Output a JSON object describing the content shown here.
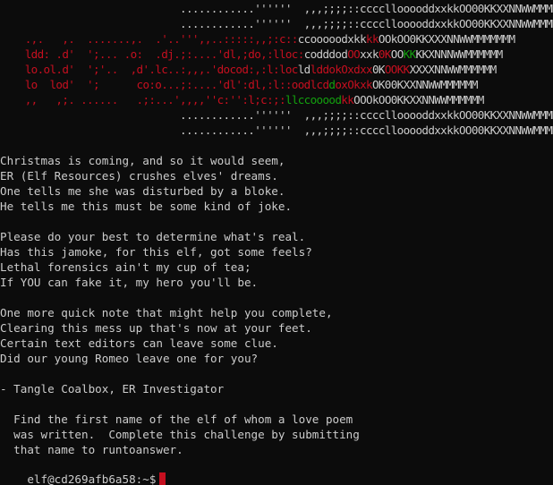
{
  "colors": {
    "background": "#0c0c0c",
    "foreground": "#cccccc",
    "red": "#c50f1f",
    "green": "#13a10e",
    "cursor": "#c50f1f"
  },
  "art": [
    [
      {
        "t": "                             ............''''''  ,,,;;;;::ccccllooooddxxkkOO00KKXXNNWWMMMMMM",
        "c": "#cccccc"
      }
    ],
    [
      {
        "t": "                             ............''''''  ,,,;;;;::ccccllooooddxxkkOO00KKXXNNWWMMMMMM",
        "c": "#cccccc"
      }
    ],
    [
      {
        "t": "    .,.   ,.  .......,.  .'..''',,..:::::,,;:c::",
        "c": "#c50f1f"
      },
      {
        "t": "ccooooodxkk",
        "c": "#cccccc"
      },
      {
        "t": "kk",
        "c": "#c50f1f"
      },
      {
        "t": "OOkOO0KKXXXNNWWMMMMMMM",
        "c": "#cccccc"
      }
    ],
    [
      {
        "t": "    ldd: .d'  ';... .o:  .dj.;:....'dl,;do,:lloc:",
        "c": "#c50f1f"
      },
      {
        "t": "codddod",
        "c": "#cccccc"
      },
      {
        "t": "OO",
        "c": "#c50f1f"
      },
      {
        "t": "xxk",
        "c": "#cccccc"
      },
      {
        "t": "0K",
        "c": "#c50f1f"
      },
      {
        "t": "OO",
        "c": "#cccccc"
      },
      {
        "t": "KK",
        "c": "#13a10e"
      },
      {
        "t": "KKXNNNWWMMMMMM",
        "c": "#cccccc"
      }
    ],
    [
      {
        "t": "    lo.ol.d'  ';'..  ,d'.lc..:,,,.'docod:,:l:loc",
        "c": "#c50f1f"
      },
      {
        "t": "ld",
        "c": "#cccccc"
      },
      {
        "t": "lddokOxdxx",
        "c": "#c50f1f"
      },
      {
        "t": "0K",
        "c": "#cccccc"
      },
      {
        "t": "OOKK",
        "c": "#c50f1f"
      },
      {
        "t": "XXXXNNWWMMMMMM",
        "c": "#cccccc"
      }
    ],
    [
      {
        "t": "    lo  lod'  ';      co:o...;:....'dl':dl,:l::oodlcd",
        "c": "#c50f1f"
      },
      {
        "t": "d",
        "c": "#13a10e"
      },
      {
        "t": "oxOkxk",
        "c": "#c50f1f"
      },
      {
        "t": "OK00KXXNNWWMMMMMM",
        "c": "#cccccc"
      }
    ],
    [
      {
        "t": "    ,,   ,;. ......   .;:...',,,,''c:'':l;c:;:",
        "c": "#c50f1f"
      },
      {
        "t": "llccooood",
        "c": "#13a10e"
      },
      {
        "t": "kk",
        "c": "#c50f1f"
      },
      {
        "t": "OOOkOO0KKXXNNWWMMMMMM",
        "c": "#cccccc"
      }
    ],
    [
      {
        "t": "                             ............''''''  ,,,;;;;::ccccllooooddxxkkOO00KKXXNNWWMMMMMM",
        "c": "#cccccc"
      }
    ],
    [
      {
        "t": "                             ............''''''  ,,,;;;;::ccccllooooddxxkkOO00KKXXNNWWMMMMMM",
        "c": "#cccccc"
      }
    ]
  ],
  "text_lines": [
    "Christmas is coming, and so it would seem,",
    "ER (Elf Resources) crushes elves' dreams.",
    "One tells me she was disturbed by a bloke.",
    "He tells me this must be some kind of joke.",
    "",
    "Please do your best to determine what's real.",
    "Has this jamoke, for this elf, got some feels?",
    "Lethal forensics ain't my cup of tea;",
    "If YOU can fake it, my hero you'll be.",
    "",
    "One more quick note that might help you complete,",
    "Clearing this mess up that's now at your feet.",
    "Certain text editors can leave some clue.",
    "Did our young Romeo leave one for you?",
    "",
    "- Tangle Coalbox, ER Investigator",
    "",
    "  Find the first name of the elf of whom a love poem",
    "  was written.  Complete this challenge by submitting",
    "  that name to runtoanswer."
  ],
  "prompt": {
    "user_host": "elf@cd269afb6a58",
    "path": "~",
    "symbol": "$"
  }
}
